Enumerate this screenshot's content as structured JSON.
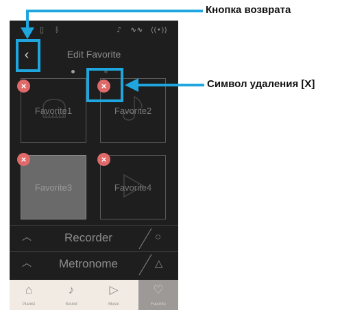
{
  "screen": {
    "title": "Edit Favorite",
    "back_icon": "chevron-left-icon",
    "page_dots": 2,
    "favorites": [
      {
        "label": "Favorite1",
        "icon": "piano-icon",
        "dimmed": false
      },
      {
        "label": "Favorite2",
        "icon": "music-note-icon",
        "dimmed": false
      },
      {
        "label": "Favorite3",
        "icon": "",
        "dimmed": true
      },
      {
        "label": "Favorite4",
        "icon": "play-icon",
        "dimmed": false
      }
    ],
    "delete_symbol": "×",
    "rows": [
      {
        "label": "Recorder",
        "icon": "circle-icon"
      },
      {
        "label": "Metronome",
        "icon": "metronome-icon"
      }
    ],
    "bottom_nav": [
      {
        "label": "Pianist",
        "icon": "piano-icon",
        "active": false
      },
      {
        "label": "Sound",
        "icon": "music-note-icon",
        "active": false
      },
      {
        "label": "Music",
        "icon": "play-icon",
        "active": false
      },
      {
        "label": "Favorite",
        "icon": "heart-icon",
        "active": true
      }
    ]
  },
  "callouts": {
    "back": "Кнопка возврата",
    "delete": "Символ удаления [X]"
  },
  "colors": {
    "accent": "#1fa6de",
    "delete_badge": "#e06a6a",
    "screen_bg": "#1e1e1e"
  }
}
